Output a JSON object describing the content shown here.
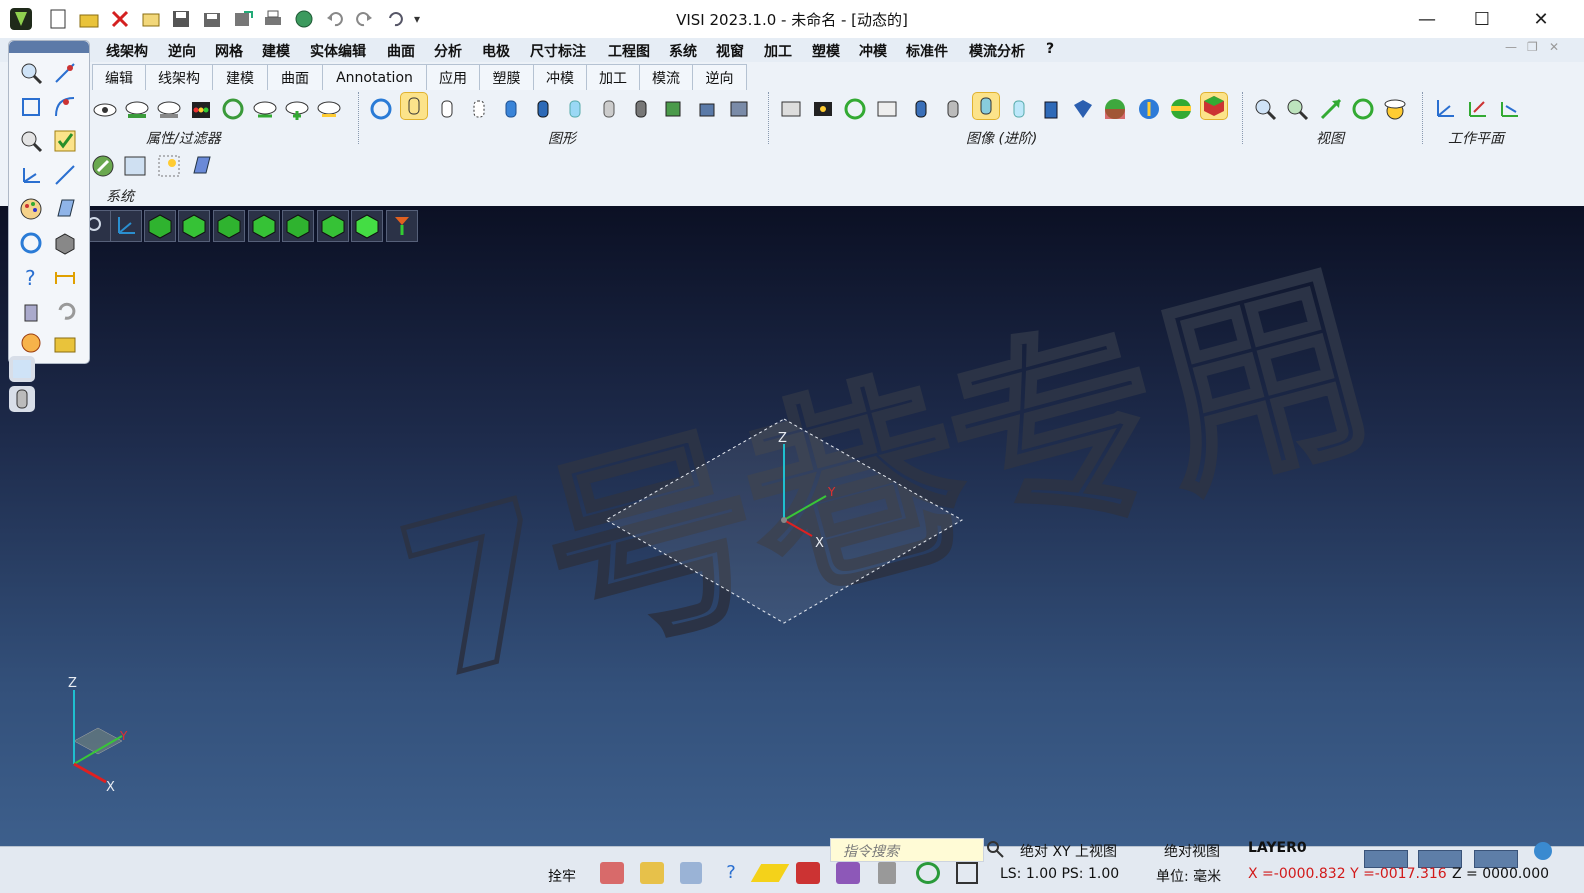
{
  "window": {
    "title": "VISI 2023.1.0 - 未命名 - [动态的]",
    "minimize": "—",
    "maximize": "☐",
    "close": "✕"
  },
  "menubar": {
    "items": [
      "线架构",
      "逆向",
      "网格",
      "建模",
      "实体编辑",
      "曲面",
      "分析",
      "电极",
      "尺寸标注",
      "工程图",
      "系统",
      "视窗",
      "加工",
      "塑模",
      "冲模",
      "标准件",
      "模流分析",
      "?"
    ]
  },
  "ribbon": {
    "tabs": [
      "编辑",
      "线架构",
      "建模",
      "曲面",
      "Annotation",
      "应用",
      "塑膜",
      "冲模",
      "加工",
      "模流",
      "逆向"
    ],
    "groups": [
      "属性/过滤器",
      "图形",
      "图像 (进阶)",
      "视图",
      "工作平面",
      "系统"
    ]
  },
  "viewport": {
    "watermark": "7号巷专用",
    "axes": {
      "z": "Z",
      "y": "Y",
      "x": "X"
    }
  },
  "statusbar": {
    "search_placeholder": "指令搜索",
    "view_mode": "绝对 XY 上视图",
    "abs_view": "绝对视图",
    "layer": "LAYER0",
    "snap": "拴牢",
    "ls_ps": "LS: 1.00 PS: 1.00",
    "unit": "单位: 毫米",
    "coords": "X =-0000.832 Y =-0017.316",
    "z_coord": "Z = 0000.000"
  },
  "colors": {
    "accent": "#1e5fb4",
    "coord_red": "#d21a1a",
    "viewport_top": "#0b1024",
    "viewport_bottom": "#3d5f8c"
  }
}
